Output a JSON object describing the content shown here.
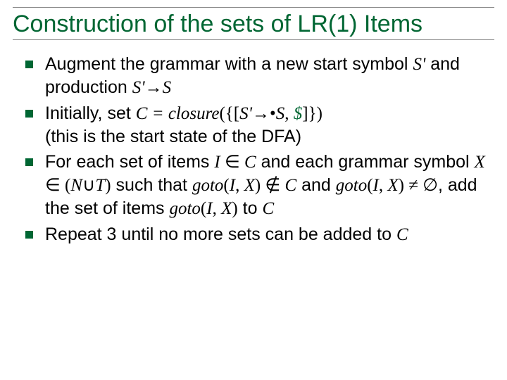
{
  "title": "Construction of the sets of LR(1) Items",
  "bullets": [
    {
      "parts": {
        "p0": "Augment the grammar with a new start symbol ",
        "s1": "S'",
        "p1": " and production ",
        "s2": "S'",
        "arrow": "→",
        "s3": "S"
      }
    },
    {
      "parts": {
        "p0": "Initially, set ",
        "cvar": "C",
        "eq": " = ",
        "closure": "closure",
        "open": "({[",
        "s1": "S'",
        "arrow": "→",
        "dot": "•",
        "s2": "S",
        "comma": ", ",
        "dollar": "$",
        "close": "]})",
        "br": " (this is the start state of the DFA)"
      }
    },
    {
      "parts": {
        "p0": "For each set of items ",
        "I": "I",
        "in1": " ∈ ",
        "C1": "C",
        "p1": " and each grammar symbol ",
        "X": "X",
        "in2": " ∈ ",
        "open": "(",
        "N": "N",
        "cup": "∪",
        "T": "T",
        "close": ")",
        "p2": " such that ",
        "goto1": "goto",
        "args1a": "(",
        "I2": "I",
        "c2": ", ",
        "X2": "X",
        "args1b": ")",
        "notin": " ∉ ",
        "C2": "C",
        "p3": " and ",
        "goto2": "goto",
        "args2a": "(",
        "I3": "I",
        "c3": ", ",
        "X3": "X",
        "args2b": ")",
        "neq": " ≠ ",
        "empty": "∅",
        "p4": ", add the set of items ",
        "goto3": "goto",
        "args3a": "(",
        "I4": "I",
        "c4": ", ",
        "X4": "X",
        "args3b": ")",
        "p5": " to ",
        "C3": "C"
      }
    },
    {
      "parts": {
        "p0": "Repeat 3 until no more sets can be added to ",
        "C": "C"
      }
    }
  ]
}
